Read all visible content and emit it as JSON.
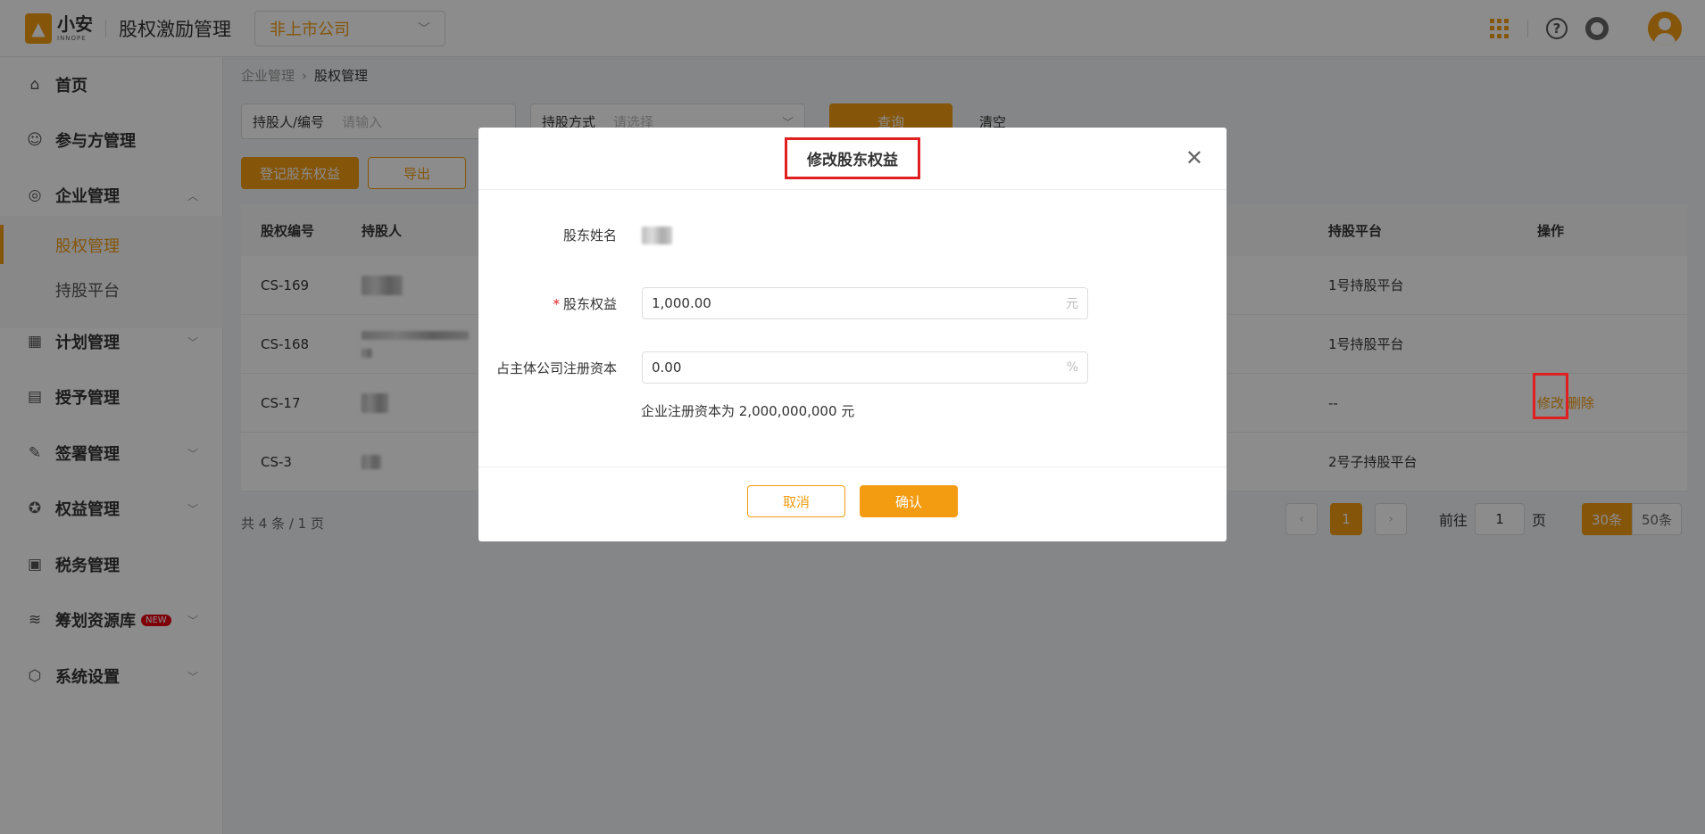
{
  "header": {
    "logo_cn": "小安",
    "logo_en": "INNOPE",
    "app_title": "股权激励管理",
    "company_select": "非上市公司"
  },
  "sidebar": {
    "items": [
      {
        "label": "首页",
        "icon": "home-icon"
      },
      {
        "label": "参与方管理",
        "icon": "users-icon"
      },
      {
        "label": "企业管理",
        "icon": "company-icon"
      },
      {
        "label": "股权管理",
        "icon": ""
      },
      {
        "label": "持股平台",
        "icon": ""
      },
      {
        "label": "计划管理",
        "icon": "plan-icon"
      },
      {
        "label": "授予管理",
        "icon": "grant-icon"
      },
      {
        "label": "签署管理",
        "icon": "sign-icon"
      },
      {
        "label": "权益管理",
        "icon": "equity-icon"
      },
      {
        "label": "税务管理",
        "icon": "tax-icon"
      },
      {
        "label": "筹划资源库",
        "icon": "layers-icon"
      },
      {
        "label": "系统设置",
        "icon": "settings-icon"
      }
    ],
    "new_badge": "NEW"
  },
  "breadcrumb": {
    "parent": "企业管理",
    "current": "股权管理"
  },
  "filters": {
    "holder_label": "持股人/编号",
    "holder_placeholder": "请输入",
    "method_label": "持股方式",
    "method_placeholder": "请选择",
    "query": "查询",
    "clear": "清空"
  },
  "actions": {
    "register": "登记股东权益",
    "export": "导出"
  },
  "table": {
    "headers": [
      "股权编号",
      "持股人",
      "持股平台",
      "操作"
    ],
    "rows": [
      {
        "id": "CS-169",
        "platform": "1号持股平台"
      },
      {
        "id": "CS-168",
        "platform": "1号持股平台"
      },
      {
        "id": "CS-17",
        "platform": "--",
        "op_edit": "修改",
        "op_delete": "删除"
      },
      {
        "id": "CS-3",
        "platform": "2号子持股平台"
      }
    ]
  },
  "pagination": {
    "total": "共 4 条 / 1 页",
    "current": "1",
    "goto_prefix": "前往",
    "goto_value": "1",
    "goto_suffix": "页",
    "size_30": "30条",
    "size_50": "50条"
  },
  "modal": {
    "title": "修改股东权益",
    "name_label": "股东姓名",
    "equity_label": "股东权益",
    "equity_value": "1,000.00",
    "equity_unit": "元",
    "ratio_label": "占主体公司注册资本",
    "ratio_value": "0.00",
    "ratio_unit": "%",
    "hint": "企业注册资本为 2,000,000,000 元",
    "cancel": "取消",
    "confirm": "确认"
  }
}
